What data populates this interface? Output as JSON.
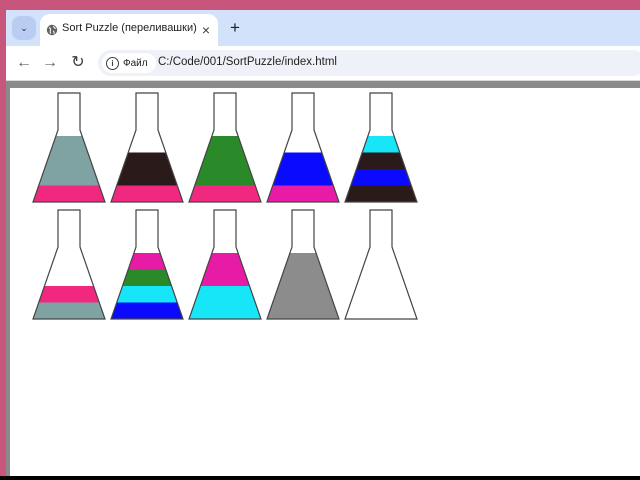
{
  "browser": {
    "tab": {
      "title": "Sort Puzzle (переливашки)",
      "favicon": "globe-icon",
      "close_icon": "×"
    },
    "new_tab_icon": "+",
    "menu_icon": "⌄",
    "nav": {
      "back_icon": "←",
      "forward_icon": "→",
      "reload_icon": "↻"
    },
    "omnibox": {
      "chip_icon": "i",
      "chip_label": "Файл",
      "url": "C:/Code/001/SortPuzzle/index.html"
    }
  },
  "game": {
    "colors": {
      "pink": "#f0287f",
      "gray_blue": "#7fa3a3",
      "dark_brown": "#2a1a1a",
      "green": "#2a8a2a",
      "blue": "#0a0aff",
      "magenta": "#e81ba6",
      "cyan": "#16e6f8",
      "gray": "#8c8c8c"
    },
    "flasks": [
      {
        "layers": [
          "pink",
          "gray_blue",
          "gray_blue",
          "gray_blue"
        ]
      },
      {
        "layers": [
          "pink",
          "dark_brown",
          "dark_brown"
        ]
      },
      {
        "layers": [
          "pink",
          "green",
          "green",
          "green"
        ]
      },
      {
        "layers": [
          "magenta",
          "blue",
          "blue"
        ]
      },
      {
        "layers": [
          "dark_brown",
          "blue",
          "dark_brown",
          "cyan"
        ]
      },
      {
        "layers": [
          "gray_blue",
          "pink"
        ]
      },
      {
        "layers": [
          "blue",
          "cyan",
          "green",
          "magenta"
        ]
      },
      {
        "layers": [
          "cyan",
          "cyan",
          "magenta",
          "magenta"
        ]
      },
      {
        "layers": [
          "gray",
          "gray",
          "gray",
          "gray"
        ]
      },
      {
        "layers": []
      }
    ]
  }
}
